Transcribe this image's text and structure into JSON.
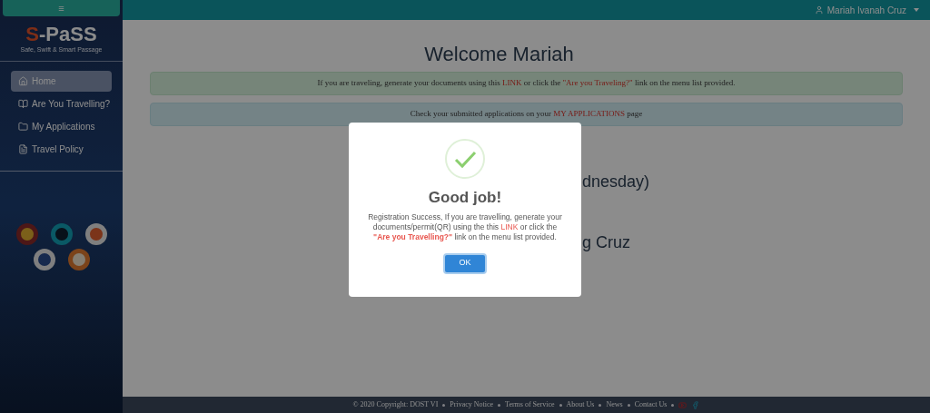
{
  "sidebar": {
    "menu_button": "≡",
    "logo": {
      "title": "S-PaSS",
      "subtitle": "Safe, Swift & Smart Passage"
    },
    "items": [
      {
        "label": "Home",
        "selected": true
      },
      {
        "label": "Are You Travelling?",
        "selected": false
      },
      {
        "label": "My Applications",
        "selected": false
      },
      {
        "label": "Travel Policy",
        "selected": false
      }
    ]
  },
  "topbar": {
    "user": "Mariah Ivanah Cruz"
  },
  "main": {
    "heading": "Welcome Mariah",
    "alerts": [
      {
        "kind": "success",
        "before": "If you are traveling, generate your documents using this ",
        "link": "LINK",
        "middle": " or click the ",
        "link2": "\"Are you Traveling?\"",
        "after": " link on the menu list provided."
      },
      {
        "kind": "info",
        "before": "Check your submitted applications on your ",
        "link": "MY APPLICATIONS",
        "after": " page"
      }
    ],
    "partial_lines": [
      "dnesday)",
      "g Cruz"
    ]
  },
  "modal": {
    "title": "Good job!",
    "text_before": "Registration Success, If you are travelling, generate your documents/permit(QR) using the this ",
    "link": "LINK",
    "text_middle": " or click the ",
    "link2": "\"Are you Travelling?\"",
    "text_after": " link on the menu list provided.",
    "button": "OK"
  },
  "footer": {
    "copyright": "© 2020 Copyright: DOST VI",
    "links": [
      "Privacy Notice",
      "Terms of Service",
      "About Us",
      "News",
      "Contact Us"
    ]
  }
}
